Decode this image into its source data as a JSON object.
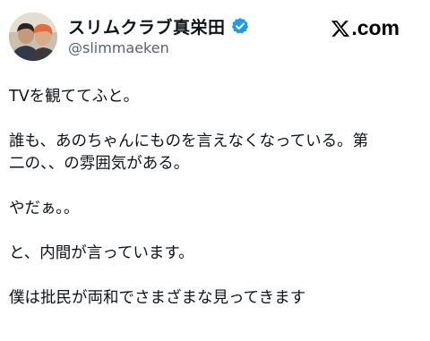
{
  "tweet": {
    "display_name": "スリムクラブ真栄田",
    "handle": "@slimmaeken",
    "site_label": ".com",
    "paragraphs": [
      [
        "TVを観ててふと。"
      ],
      [
        "誰も、あのちゃんにものを言えなくなっている。第",
        "二の、、の雰囲気がある。"
      ],
      [
        "やだぁ。。"
      ],
      [
        "と、内間が言っています。"
      ],
      [
        "僕は批民が両和でさまざまな見ってきます"
      ]
    ]
  },
  "icons": {
    "verified": "verified-badge-icon",
    "x_logo": "x-logo-icon"
  },
  "colors": {
    "verified_blue": "#1d9bf0",
    "handle_gray": "#536471",
    "text": "#0f1419"
  }
}
